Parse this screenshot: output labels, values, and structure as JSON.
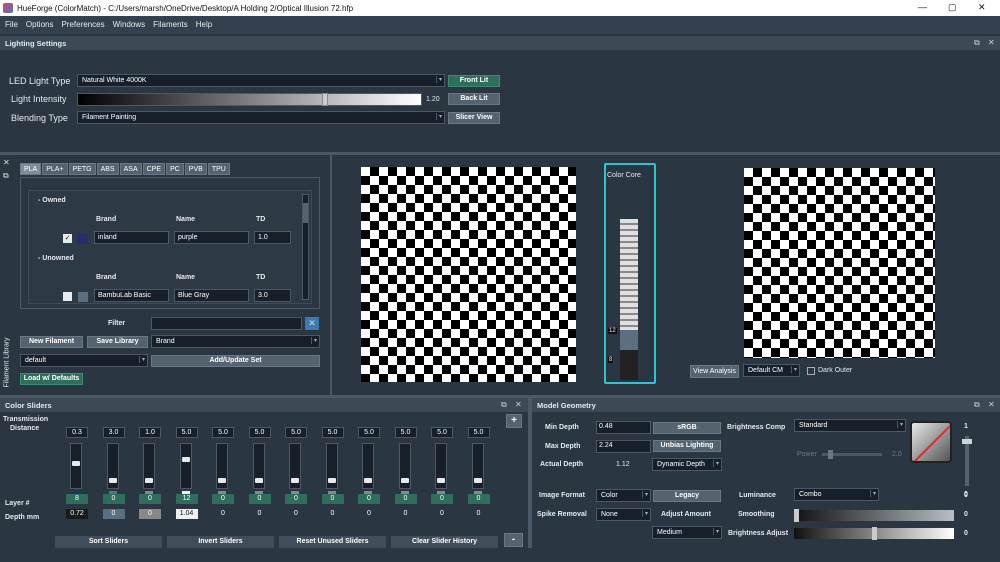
{
  "window": {
    "title": "HueForge (ColorMatch) - C:/Users/marsh/OneDrive/Desktop/A Holding 2/Optical Illusion 72.hfp",
    "controls": [
      "—",
      "▢",
      "✕"
    ]
  },
  "menu": [
    "File",
    "Options",
    "Preferences",
    "Windows",
    "Filaments",
    "Help"
  ],
  "lighting": {
    "title": "Lighting Settings",
    "led_label": "LED Light Type",
    "led_value": "Natural White 4000K",
    "intensity_label": "Light Intensity",
    "intensity_value": "1.20",
    "intensity_fraction": 0.72,
    "blending_label": "Blending Type",
    "blending_value": "Filament Painting",
    "front_lit": "Front Lit",
    "back_lit": "Back Lit",
    "slicer_view": "Slicer View"
  },
  "library": {
    "side_label": "Filament Library",
    "tabs": [
      "PLA",
      "PLA+",
      "PETG",
      "ABS",
      "ASA",
      "CPE",
      "PC",
      "PVB",
      "TPU"
    ],
    "owned_header": "- Owned",
    "unowned_header": "- Unowned",
    "col_brand": "Brand",
    "col_name": "Name",
    "col_td": "TD",
    "owned_row": {
      "brand": "inland",
      "name": "purple",
      "td": "1.0",
      "color": "#2a2a6e"
    },
    "unowned_row": {
      "brand": "BambuLab Basic",
      "name": "Blue Gray",
      "td": "3.0",
      "color": "#5c6f80"
    },
    "filter_label": "Filter",
    "new_filament": "New Filament",
    "save_library": "Save Library",
    "sort_value": "Brand",
    "set_value": "default",
    "add_update": "Add/Update Set",
    "load_defaults": "Load w/ Defaults"
  },
  "color_core": {
    "title": "Color Core",
    "marker_top": "12",
    "marker_bottom": "8"
  },
  "preview": {
    "view_analysis": "View Analysis",
    "cm_value": "Default CM",
    "dark_outer": "Dark Outer"
  },
  "sliders": {
    "title": "Color Sliders",
    "transmission_label": "Transmission",
    "distance_label": "Distance",
    "layer_label": "Layer #",
    "depth_label": "Depth mm",
    "td_values": [
      "0.3",
      "3.0",
      "1.0",
      "5.0",
      "5.0",
      "5.0",
      "5.0",
      "5.0",
      "5.0",
      "5.0",
      "5.0",
      "5.0"
    ],
    "layers": [
      "8",
      "0",
      "0",
      "12",
      "0",
      "0",
      "0",
      "0",
      "0",
      "0",
      "0",
      "0"
    ],
    "depths": [
      "0.72",
      "0",
      "0",
      "1.04",
      "0",
      "0",
      "0",
      "0",
      "0",
      "0",
      "0",
      "0"
    ],
    "handle_levels": [
      0.55,
      0.1,
      0.1,
      0.65,
      0.1,
      0.1,
      0.1,
      0.1,
      0.1,
      0.1,
      0.1,
      0.1
    ],
    "swatches": [
      "#2a2a6e",
      "#5c6f80",
      "#888888",
      "#f0f0f0",
      "#888888",
      "#888888",
      "#888888",
      "#888888",
      "#888888",
      "#888888",
      "#888888",
      "#888888"
    ],
    "sort_sliders": "Sort Sliders",
    "invert_sliders": "Invert Sliders",
    "reset_unused": "Reset Unused Sliders",
    "clear_history": "Clear Slider History",
    "plus": "+",
    "minus": "-"
  },
  "geometry": {
    "title": "Model Geometry",
    "min_depth_label": "Min Depth",
    "min_depth": "0.48",
    "max_depth_label": "Max Depth",
    "max_depth": "2.24",
    "actual_depth_label": "Actual Depth",
    "actual_depth": "1.12",
    "srgb": "sRGB",
    "unbias": "Unbias Lighting",
    "dynamic_depth": "Dynamic Depth",
    "brightness_comp_label": "Brightness Comp",
    "brightness_comp": "Standard",
    "power_label": "Power",
    "power_value": "2.0",
    "image_format_label": "Image Format",
    "image_format": "Color",
    "legacy": "Legacy",
    "luminance_label": "Luminance",
    "luminance": "Combo",
    "spike_label": "Spike Removal",
    "spike_value": "None",
    "adjust_label": "Adjust Amount",
    "adjust_value": "Medium",
    "smoothing_label": "Smoothing",
    "smoothing_value": "0",
    "brightness_adjust_label": "Brightness Adjust",
    "brightness_adjust_value": "0",
    "luminance_value": "0",
    "vslider_top": "1",
    "vslider_bottom": "0"
  }
}
